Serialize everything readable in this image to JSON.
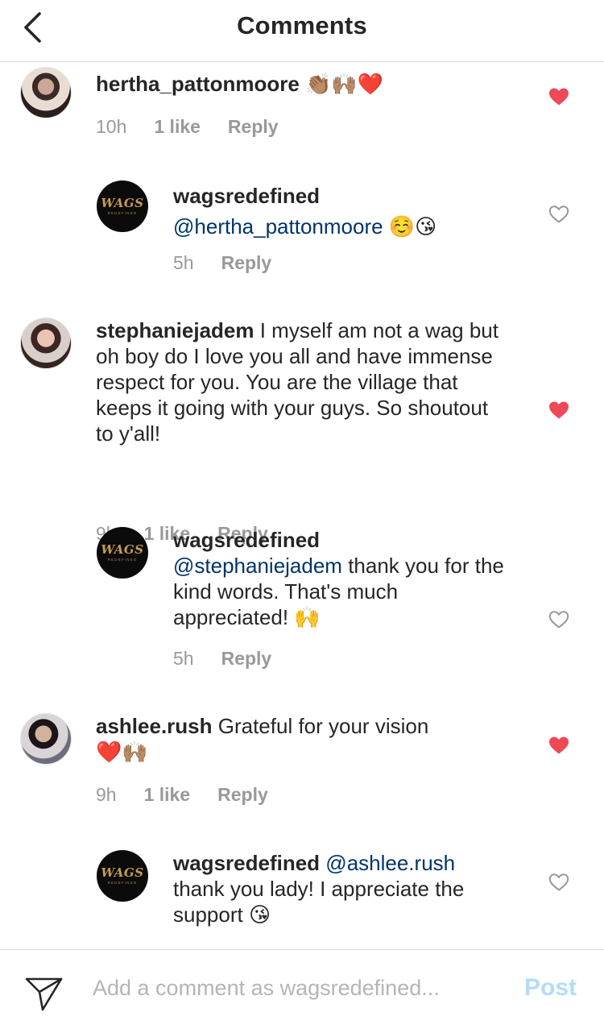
{
  "header": {
    "title": "Comments"
  },
  "comments": [
    {
      "username": "hertha_pattonmoore",
      "text": " ",
      "emoji": "👏🏽🙌🏽❤️",
      "time": "10h",
      "likes": "1 like",
      "reply": "Reply",
      "liked": true
    },
    {
      "username": "wagsredefined",
      "mention": "@hertha_pattonmoore",
      "emoji": "☺️😘",
      "time": "5h",
      "reply": "Reply",
      "liked": false
    },
    {
      "username": "stephaniejadem",
      "text": " I myself am not a wag but oh boy do I love you all and have immense respect for you. You are the village that keeps it going with your guys. So shoutout to y'all!",
      "time": "9h",
      "likes": "1 like",
      "reply": "Reply",
      "liked": true
    },
    {
      "username": "wagsredefined",
      "mention": "@stephaniejadem",
      "text": " thank you for the kind words. That's much appreciated! ",
      "emoji": "🙌",
      "time": "5h",
      "reply": "Reply",
      "liked": false
    },
    {
      "username": "ashlee.rush",
      "text": " Grateful for your vision",
      "emoji": "❤️🙌🏽",
      "time": "9h",
      "likes": "1 like",
      "reply": "Reply",
      "liked": true
    },
    {
      "username": "wagsredefined",
      "mention": "@ashlee.rush",
      "text": " thank you lady! I appreciate the support ",
      "emoji": "😘",
      "liked": false
    }
  ],
  "brand_avatar": {
    "logo": "WAGS",
    "subtitle": "REDEFINED"
  },
  "composer": {
    "placeholder": "Add a comment as wagsredefined...",
    "post_label": "Post"
  },
  "colors": {
    "heart_liked": "#ed4956",
    "heart_empty": "#999999",
    "mention": "#003569",
    "post_disabled": "#b3dbff"
  },
  "icons": {
    "back": "chevron-left-icon",
    "heart": "heart-icon",
    "send": "paper-plane-icon"
  }
}
